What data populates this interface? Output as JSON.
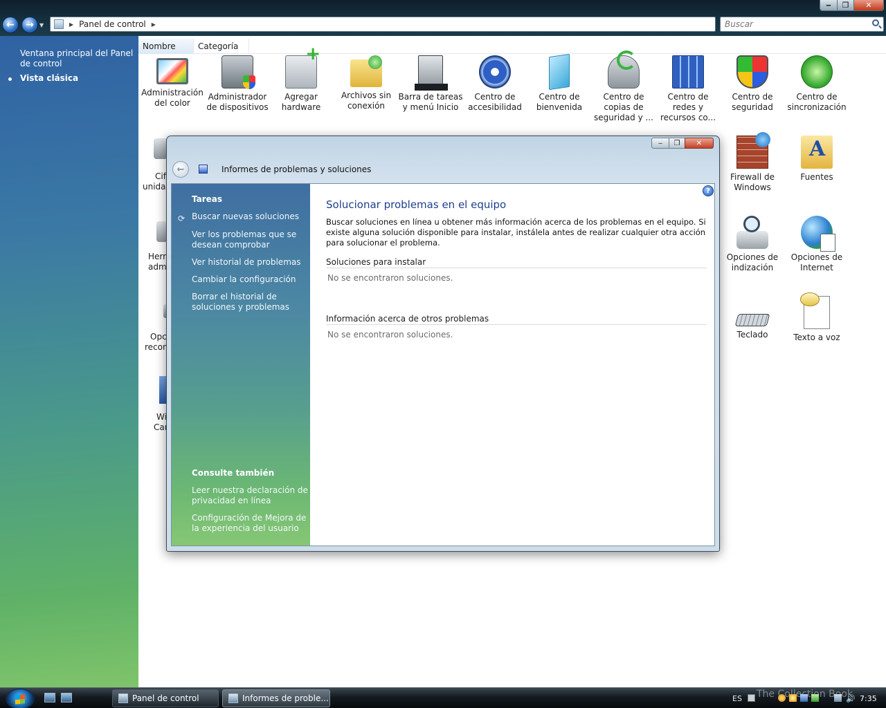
{
  "address": {
    "segments": [
      "Panel de control"
    ]
  },
  "search": {
    "placeholder": "Buscar"
  },
  "left_pane": {
    "home_link": "Ventana principal del Panel de control",
    "classic_view": "Vista clásica"
  },
  "columns": [
    "Nombre",
    "Categoría"
  ],
  "items": [
    {
      "label": "Administración del color",
      "icon": "color-management-icon"
    },
    {
      "label": "Administrador de dispositivos",
      "icon": "device-manager-icon"
    },
    {
      "label": "Agregar hardware",
      "icon": "add-hardware-icon"
    },
    {
      "label": "Archivos sin conexión",
      "icon": "offline-files-icon"
    },
    {
      "label": "Barra de tareas y menú Inicio",
      "icon": "taskbar-start-menu-icon"
    },
    {
      "label": "Centro de accesibilidad",
      "icon": "ease-of-access-icon"
    },
    {
      "label": "Centro de bienvenida",
      "icon": "welcome-center-icon"
    },
    {
      "label": "Centro de copias de seguridad y ...",
      "icon": "backup-center-icon"
    },
    {
      "label": "Centro de redes y recursos co...",
      "icon": "network-center-icon"
    },
    {
      "label": "Centro de seguridad",
      "icon": "security-center-icon"
    },
    {
      "label": "Centro de sincronización",
      "icon": "sync-center-icon"
    },
    {
      "label": "Firewall de Windows",
      "icon": "firewall-icon"
    },
    {
      "label": "Fuentes",
      "icon": "fonts-icon"
    },
    {
      "label": "Opciones de indización",
      "icon": "indexing-options-icon"
    },
    {
      "label": "Opciones de Internet",
      "icon": "internet-options-icon"
    },
    {
      "label": "Teclado",
      "icon": "keyboard-icon"
    },
    {
      "label": "Texto a voz",
      "icon": "text-to-speech-icon"
    }
  ],
  "partial_items": [
    "Cif",
    "unidad",
    "Herra",
    "admin",
    "Opc",
    "recon",
    "Wi",
    "Car"
  ],
  "dialog": {
    "title": "Informes de problemas y soluciones",
    "tasks_header": "Tareas",
    "tasks": [
      "Buscar nuevas soluciones",
      "Ver los problemas que se desean comprobar",
      "Ver historial de problemas",
      "Cambiar la configuración",
      "Borrar el historial de soluciones y problemas"
    ],
    "see_also_header": "Consulte también",
    "see_also": [
      "Leer nuestra declaración de privacidad en línea",
      "Configuración de Mejora de la experiencia del usuario"
    ],
    "content_title": "Solucionar problemas en el equipo",
    "content_desc": "Buscar soluciones en línea u obtener más información acerca de los problemas en el equipo. Si existe alguna solución disponible para instalar, instálela antes de realizar cualquier otra acción para solucionar el problema.",
    "sections": [
      {
        "title": "Soluciones para instalar",
        "empty": "No se encontraron soluciones."
      },
      {
        "title": "Información acerca de otros problemas",
        "empty": "No se encontraron soluciones."
      }
    ]
  },
  "taskbar": {
    "buttons": [
      "Panel de control",
      "Informes de proble..."
    ],
    "language": "ES",
    "watermark": "The Collection Book",
    "clock": "7:35"
  }
}
